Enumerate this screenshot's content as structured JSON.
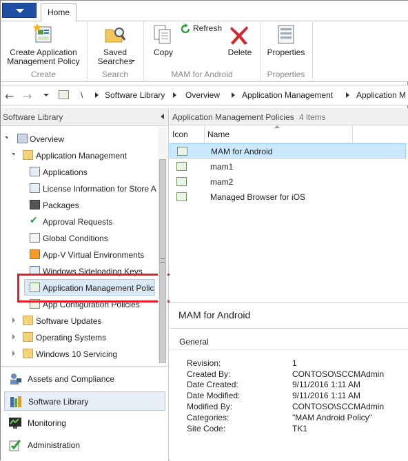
{
  "ribbon": {
    "tab_home": "Home",
    "create_policy": "Create Application\nManagement Policy",
    "saved_searches": "Saved\nSearches",
    "refresh": "Refresh",
    "copy": "Copy",
    "delete": "Delete",
    "properties": "Properties",
    "group_create": "Create",
    "group_search": "Search",
    "group_mam": "MAM for Android",
    "group_properties": "Properties"
  },
  "breadcrumb": {
    "root": "\\",
    "items": [
      "Software Library",
      "Overview",
      "Application Management",
      "Application M"
    ]
  },
  "leftpane": {
    "title": "Software Library",
    "tree": [
      {
        "label": "Overview"
      },
      {
        "label": "Application Management"
      },
      {
        "label": "Applications"
      },
      {
        "label": "License Information for Store A"
      },
      {
        "label": "Packages"
      },
      {
        "label": "Approval Requests"
      },
      {
        "label": "Global Conditions"
      },
      {
        "label": "App-V Virtual Environments"
      },
      {
        "label": "Windows Sideloading Keys"
      },
      {
        "label": "Application Management Polic"
      },
      {
        "label": "App Configuration Policies"
      },
      {
        "label": "Software Updates"
      },
      {
        "label": "Operating Systems"
      },
      {
        "label": "Windows 10 Servicing"
      }
    ],
    "workspaces": [
      {
        "label": "Assets and Compliance",
        "icon": "assets-icon"
      },
      {
        "label": "Software Library",
        "icon": "software-library-icon"
      },
      {
        "label": "Monitoring",
        "icon": "monitoring-icon"
      },
      {
        "label": "Administration",
        "icon": "administration-icon"
      }
    ]
  },
  "list": {
    "title": "Application Management Policies",
    "count": "4 items",
    "columns": [
      "Icon",
      "Name"
    ],
    "rows": [
      {
        "name": "MAM for Android"
      },
      {
        "name": "mam1"
      },
      {
        "name": "mam2"
      },
      {
        "name": "Managed Browser for iOS"
      }
    ]
  },
  "detail": {
    "title": "MAM for Android",
    "section": "General",
    "fields": [
      {
        "key": "Revision:",
        "value": "1"
      },
      {
        "key": "Created By:",
        "value": "CONTOSO\\SCCMAdmin"
      },
      {
        "key": "Date Created:",
        "value": "9/11/2016 1:11 AM"
      },
      {
        "key": "Date Modified:",
        "value": "9/11/2016 1:11 AM"
      },
      {
        "key": "Modified By:",
        "value": "CONTOSO\\SCCMAdmin"
      },
      {
        "key": "Categories:",
        "value": "\"MAM Android Policy\""
      },
      {
        "key": "Site Code:",
        "value": "TK1"
      }
    ]
  },
  "colors": {
    "highlight_box": "#e0202a",
    "selected_row": "#cce8ff",
    "app_button": "#1e4fa5"
  }
}
